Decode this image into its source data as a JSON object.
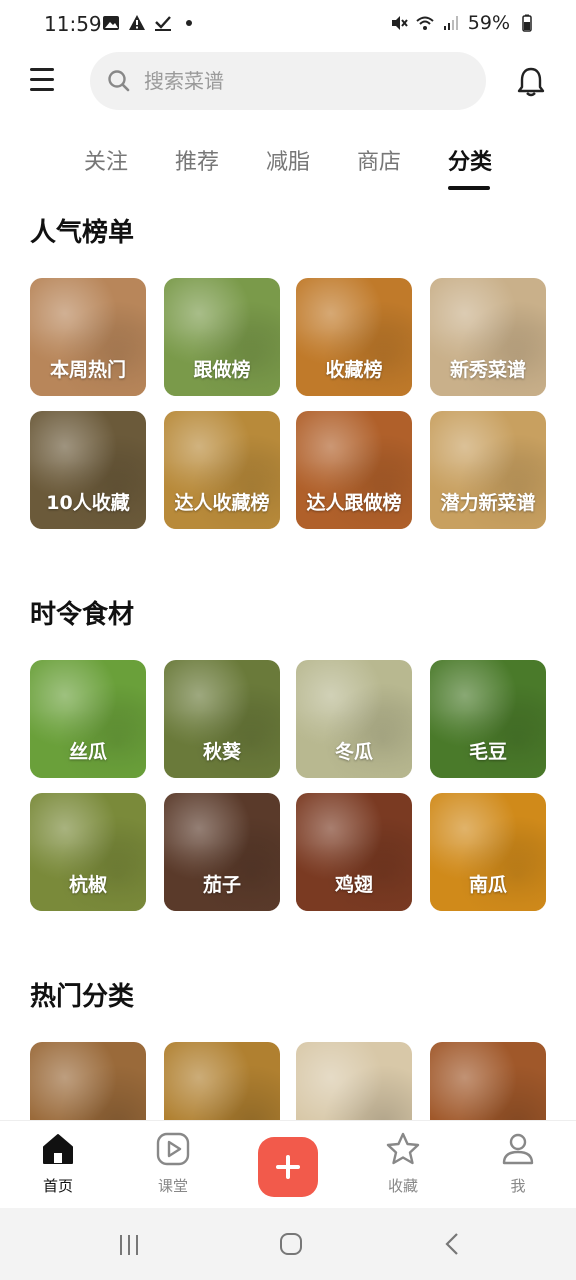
{
  "status_bar": {
    "time": "11:59",
    "battery": "59%",
    "left_icons": [
      "image-icon",
      "alert-icon",
      "check-icon",
      "dot-icon"
    ],
    "right_icons": [
      "mute-icon",
      "wifi-icon",
      "signal-icon",
      "battery-icon"
    ]
  },
  "search": {
    "placeholder": "搜索菜谱"
  },
  "tabs": [
    {
      "label": "关注",
      "active": false
    },
    {
      "label": "推荐",
      "active": false
    },
    {
      "label": "减脂",
      "active": false
    },
    {
      "label": "商店",
      "active": false
    },
    {
      "label": "分类",
      "active": true
    }
  ],
  "sections": {
    "popular": {
      "title": "人气榜单",
      "tiles": [
        {
          "label": "本周热门",
          "color": "#b8865a"
        },
        {
          "label": "跟做榜",
          "color": "#7a9a4a"
        },
        {
          "label": "收藏榜",
          "color": "#c07a2a"
        },
        {
          "label": "新秀菜谱",
          "color": "#c9b08a"
        },
        {
          "label": "10人收藏",
          "color": "#6b5a3a"
        },
        {
          "label": "达人收藏榜",
          "color": "#b88a3a"
        },
        {
          "label": "达人跟做榜",
          "color": "#b0602a"
        },
        {
          "label": "潜力新菜谱",
          "color": "#c8a060"
        }
      ]
    },
    "seasonal": {
      "title": "时令食材",
      "tiles": [
        {
          "label": "丝瓜",
          "color": "#6aa03a"
        },
        {
          "label": "秋葵",
          "color": "#6a7a3a"
        },
        {
          "label": "冬瓜",
          "color": "#b8b890"
        },
        {
          "label": "毛豆",
          "color": "#4a7a2a"
        },
        {
          "label": "杭椒",
          "color": "#7a8a3a"
        },
        {
          "label": "茄子",
          "color": "#5a3a2a"
        },
        {
          "label": "鸡翅",
          "color": "#7a3a22"
        },
        {
          "label": "南瓜",
          "color": "#d08a1a"
        }
      ]
    },
    "hot_categories": {
      "title": "热门分类",
      "tiles": [
        {
          "label": "",
          "color": "#9a6a3a"
        },
        {
          "label": "",
          "color": "#b08030"
        },
        {
          "label": "",
          "color": "#d8c8a8"
        },
        {
          "label": "",
          "color": "#a0582a"
        }
      ]
    }
  },
  "bottom_nav": [
    {
      "label": "首页",
      "icon": "home-icon",
      "active": true
    },
    {
      "label": "课堂",
      "icon": "play-icon",
      "active": false
    },
    {
      "label": "",
      "icon": "plus-icon",
      "active": false
    },
    {
      "label": "收藏",
      "icon": "star-icon",
      "active": false
    },
    {
      "label": "我",
      "icon": "user-icon",
      "active": false
    }
  ],
  "colors": {
    "accent": "#f25a4b",
    "text": "#111111",
    "muted": "#888888"
  }
}
